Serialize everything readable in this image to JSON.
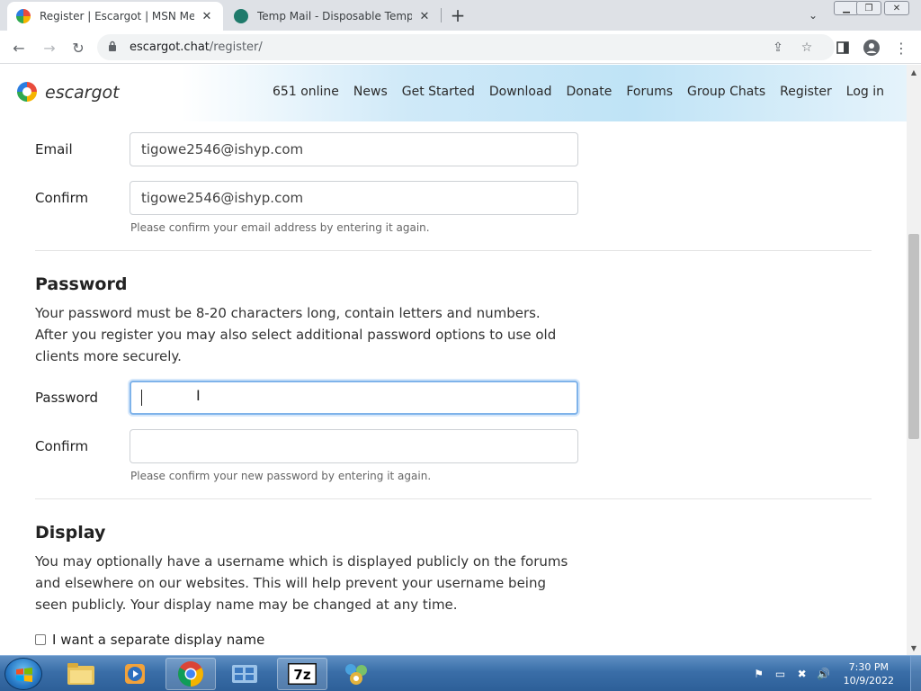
{
  "browser": {
    "tabs": [
      {
        "title": "Register | Escargot | MSN Messenger",
        "active": true
      },
      {
        "title": "Temp Mail - Disposable Temporary Email",
        "active": false
      }
    ],
    "url_host": "escargot.chat",
    "url_path": "/register/"
  },
  "site": {
    "logo_text": "escargot",
    "nav": [
      "651 online",
      "News",
      "Get Started",
      "Download",
      "Donate",
      "Forums",
      "Group Chats",
      "Register",
      "Log in"
    ]
  },
  "form": {
    "email_label": "Email",
    "email_value": "tigowe2546@ishyp.com",
    "confirm_label": "Confirm",
    "confirm_email_value": "tigowe2546@ishyp.com",
    "email_hint": "Please confirm your email address by entering it again.",
    "password_heading": "Password",
    "password_desc": "Your password must be 8-20 characters long, contain letters and numbers. After you register you may also select additional password options to use old clients more securely.",
    "password_label": "Password",
    "password_value": "",
    "confirm_password_label": "Confirm",
    "confirm_password_value": "",
    "password_hint": "Please confirm your new password by entering it again.",
    "display_heading": "Display",
    "display_desc": "You may optionally have a username which is displayed publicly on the forums and elsewhere on our websites. This will help prevent your username being seen publicly. Your display name may be changed at any time.",
    "display_checkbox_label": "I want a separate display name",
    "display_checkbox_checked": false
  },
  "taskbar": {
    "time": "7:30 PM",
    "date": "10/9/2022",
    "apps": [
      "windows-explorer",
      "media-player",
      "chrome",
      "control-panel",
      "7zip",
      "network-tool"
    ]
  },
  "colors": {
    "focus_border": "#7fb3ea",
    "header_gradient": "#bfe3f6",
    "taskbar": "#3a6ea8"
  }
}
